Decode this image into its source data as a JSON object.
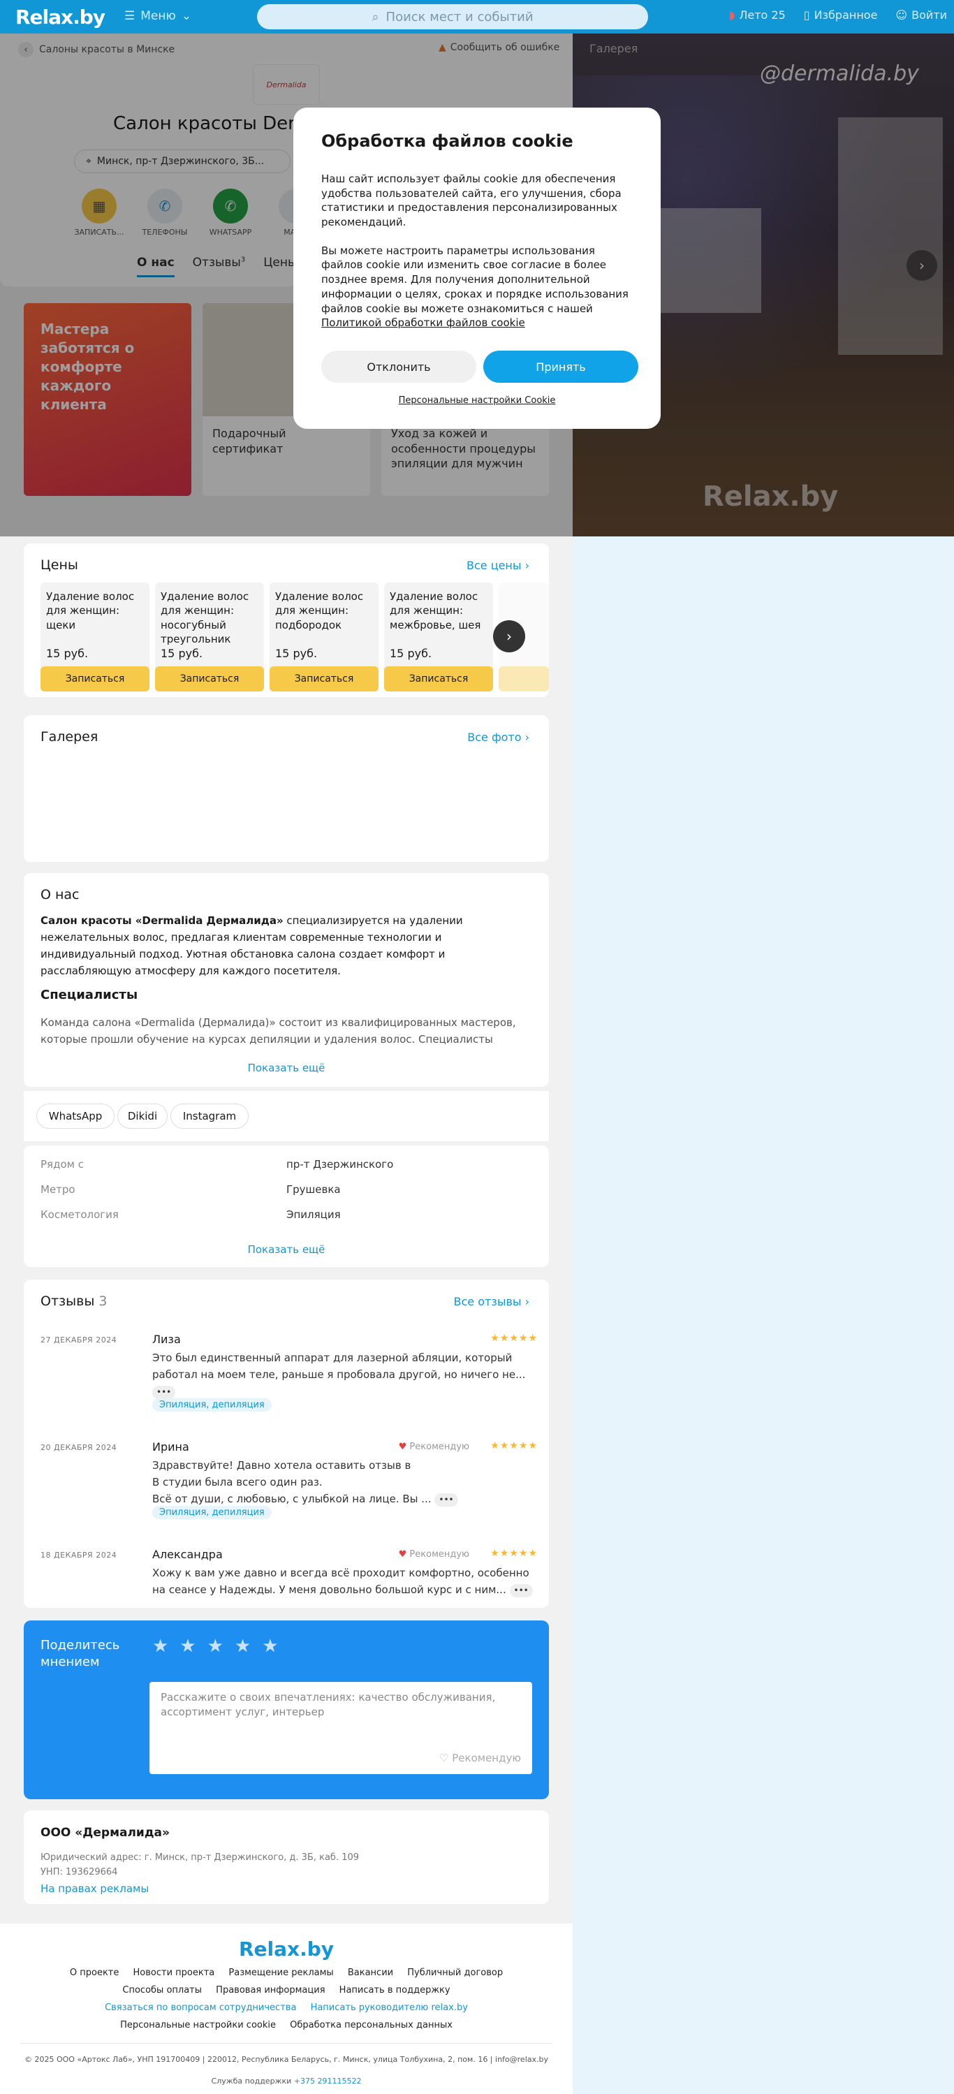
{
  "topbar": {
    "logo": "Relax.by",
    "menu": "Меню",
    "search_placeholder": "Поиск мест и событий",
    "summer": "Лето 25",
    "favorites": "Избранное",
    "login": "Войти"
  },
  "hero": {
    "breadcrumb": "Салоны красоты в Минске",
    "report": "Сообщить об ошибке",
    "logo_text": "Dermalida",
    "title": "Салон красоты Dermalida",
    "address": "Минск, пр-т Дзержинского, 3Б...",
    "actions": [
      {
        "label": "ЗАПИСАТЬ...",
        "color": "#f7c948"
      },
      {
        "label": "ТЕЛЕФОНЫ",
        "color": "#e8eef3"
      },
      {
        "label": "WHATSAPP",
        "color": "#25a244"
      },
      {
        "label": "МАРШ",
        "color": "#e8eef3"
      }
    ],
    "tabs": [
      {
        "label": "О нас"
      },
      {
        "label": "Отзывы",
        "count": "3"
      },
      {
        "label": "Цены"
      }
    ]
  },
  "promos": [
    {
      "text": "Мастера заботятся о комфорте каждого клиента"
    },
    {
      "text": "Подарочный сертификат"
    },
    {
      "text": "Уход за кожей и особенности процедуры эпиляции для мужчин"
    }
  ],
  "prices": {
    "title": "Цены",
    "all_link": "Все цены",
    "items": [
      {
        "name": "Удаление волос для женщин: щеки",
        "price": "15 руб.",
        "button": "Записаться"
      },
      {
        "name": "Удаление волос для женщин: носогубный треугольник",
        "price": "15 руб.",
        "button": "Записаться"
      },
      {
        "name": "Удаление волос для женщин: подбородок",
        "price": "15 руб.",
        "button": "Записаться"
      },
      {
        "name": "Удаление волос для женщин: межбровье, шея",
        "price": "15 руб.",
        "button": "Записаться"
      }
    ]
  },
  "gallery": {
    "title": "Галерея",
    "all_link": "Все фото"
  },
  "about": {
    "title": "О нас",
    "text_bold": "Салон красоты «Dermalida Дермалида»",
    "text_rest": " специализируется на удалении нежелательных волос, предлагая клиентам современные технологии и индивидуальный подход. Уютная обстановка салона создает комфорт и расслабляющую атмосферу для каждого посетителя.",
    "spec_title": "Специалисты",
    "spec_text": "Команда салона «Dermalida (Дермалида)» состоит из квалифицированных мастеров, которые прошли обучение на курсах депиляции и удаления волос. Специалисты",
    "show_more": "Показать ещё"
  },
  "social": [
    "WhatsApp",
    "Dikidi",
    "Instagram"
  ],
  "facts": {
    "items": [
      {
        "key": "Рядом с",
        "value": "пр-т Дзержинского"
      },
      {
        "key": "Метро",
        "value": "Грушевка"
      },
      {
        "key": "Косметология",
        "value": "Эпиляция"
      }
    ],
    "show_more": "Показать ещё"
  },
  "reviews": {
    "title": "Отзывы",
    "count": "3",
    "all_link": "Все отзывы",
    "recommend": "Рекомендую",
    "items": [
      {
        "date": "27 ДЕКАБРЯ 2024",
        "name": "Лиза",
        "text": "Это был единственный аппарат для лазерной абляции, который работал на моем теле, раньше я пробовала другой, но ничего не...",
        "tag": "Эпиляция, депиляция",
        "recommend": false
      },
      {
        "date": "20 ДЕКАБРЯ 2024",
        "name": "Ирина",
        "text1": "Здравствуйте! Давно хотела оставить отзыв в",
        "text2": "В студии была всего один раз.",
        "text3": "Всё от души, с любовью, с улыбкой на лице. Вы ...",
        "tag": "Эпиляция, депиляция",
        "recommend": true
      },
      {
        "date": "18 ДЕКАБРЯ 2024",
        "name": "Александра",
        "text": "Хожу к вам уже давно и всегда всё проходит комфортно, особенно на сеансе у Надежды. У меня довольно большой курс и с ним...",
        "recommend": true
      }
    ]
  },
  "share": {
    "title": "Поделитесь мнением",
    "placeholder": "Расскажите о своих впечатлениях: качество обслуживания, ассортимент услуг, интерьер",
    "recommend": "Рекомендую"
  },
  "company": {
    "name": "ООО «Дермалида»",
    "address": "Юридический адрес: г. Минск, пр-т Дзержинского, д. 3Б, каб. 109",
    "unp": "УНП: 193629664",
    "ad": "На правах рекламы"
  },
  "footer": {
    "logo": "Relax.by",
    "row1": [
      "О проекте",
      "Новости проекта",
      "Размещение рекламы",
      "Вакансии",
      "Публичный договор"
    ],
    "row2": [
      "Способы оплаты",
      "Правовая информация",
      "Написать в поддержку"
    ],
    "row3": [
      "Связаться по вопросам сотрудничества",
      "Написать руководителю relax.by"
    ],
    "row4": [
      "Персональные настройки cookie",
      "Обработка персональных данных"
    ],
    "copyright": "© 2025 ООО «Артокс Лаб», УНП 191700409 | 220012, Республика Беларусь, г. Минск, улица Толбухина, 2, пом. 16 | info@relax.by",
    "support_label": "Служба поддержки",
    "support_phone": "+375 291115522"
  },
  "right_gallery": {
    "label": "Галерея",
    "sign": "@dermalida.by",
    "watermark": "Relax.by"
  },
  "cookie": {
    "title": "Обработка файлов cookie",
    "p1": "Наш сайт использует файлы cookie для обеспечения удобства пользователей сайта, его улучшения, сбора статистики и предоставления персонализированных рекомендаций.",
    "p2": "Вы можете настроить параметры использования файлов cookie или изменить свое согласие в более позднее время. Для получения дополнительной информации о целях, сроках и порядке использования файлов cookie вы можете ознакомиться с нашей",
    "policy_link": "Политикой обработки файлов cookie",
    "decline": "Отклонить",
    "accept": "Принять",
    "personal": "Персональные настройки Cookie"
  }
}
